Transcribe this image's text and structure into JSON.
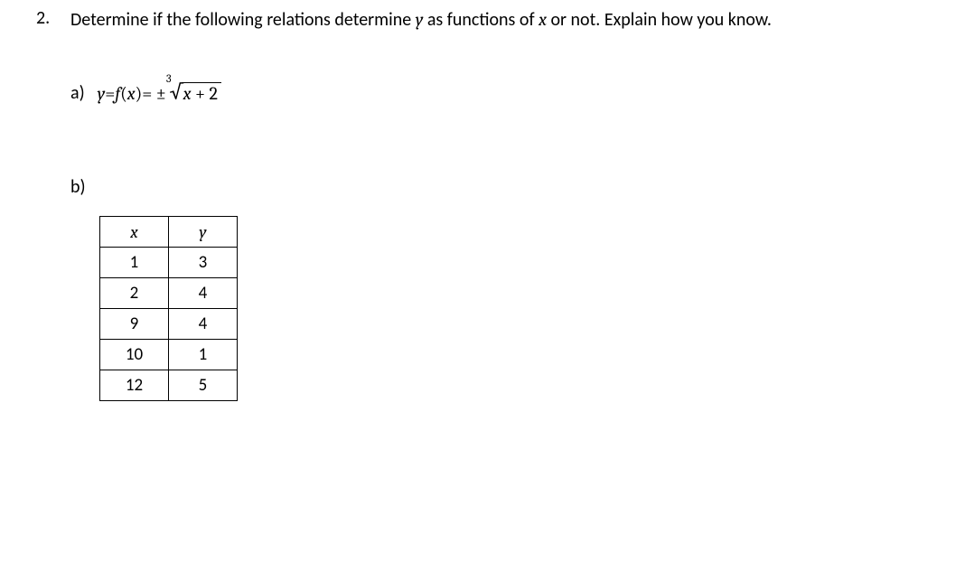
{
  "question": {
    "number": "2.",
    "text_part1": "Determine if the following relations determine ",
    "var_y": "y",
    "text_part2": " as functions of ",
    "var_x": "x",
    "text_part3": " or not.  Explain how you know."
  },
  "part_a": {
    "label": "a)",
    "lhs1": "y",
    "eq": " = ",
    "lhs2": "f",
    "paren_open": "(",
    "lhs2_arg": "x",
    "paren_close": ")",
    "eq2": " = ± ",
    "root_index": "3",
    "radicand_var": "x",
    "radicand_rest": " + 2"
  },
  "part_b": {
    "label": "b)",
    "headers": {
      "x": "x",
      "y": "y"
    },
    "rows": [
      {
        "x": "1",
        "y": "3"
      },
      {
        "x": "2",
        "y": "4"
      },
      {
        "x": "9",
        "y": "4"
      },
      {
        "x": "10",
        "y": "1"
      },
      {
        "x": "12",
        "y": "5"
      }
    ]
  }
}
